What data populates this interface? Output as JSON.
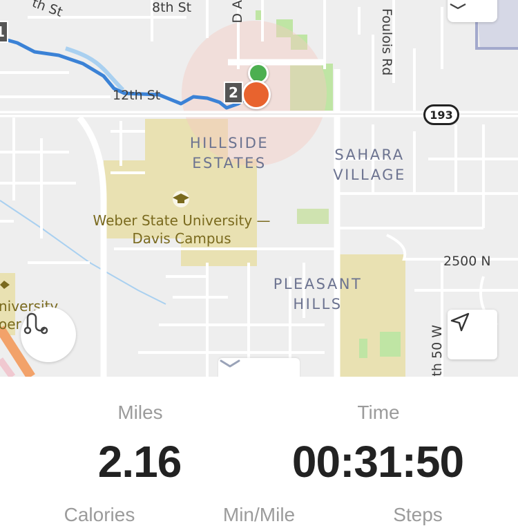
{
  "map": {
    "street_labels": [
      "8th St",
      "12th St",
      "Foulois Rd",
      "2500 N",
      "D A",
      "th St",
      "th 50 W"
    ],
    "route_shield": "193",
    "area_labels": [
      {
        "line1": "HILLSIDE",
        "line2": "ESTATES"
      },
      {
        "line1": "SAHARA",
        "line2": "VILLAGE"
      },
      {
        "line1": "PLEASANT",
        "line2": "HILLS"
      }
    ],
    "poi": {
      "line1": "Weber State University —",
      "line2": "Davis Campus"
    },
    "poi_partial": {
      "line1": "niversity",
      "line2": "oer"
    },
    "split_markers": [
      "1",
      "2"
    ],
    "start_marker_color": "#4caf50",
    "end_marker_color": "#e8632e",
    "route_color": "#3b82d6",
    "icons": {
      "route": "route-toggle-icon",
      "locate": "locate-arrow-icon",
      "layers": "layers-icon",
      "collapse": "chevron-down-icon"
    }
  },
  "stats": {
    "miles": {
      "label": "Miles",
      "value": "2.16"
    },
    "time": {
      "label": "Time",
      "value": "00:31:50"
    },
    "calories": {
      "label": "Calories"
    },
    "pace": {
      "label": "Min/Mile"
    },
    "steps": {
      "label": "Steps"
    }
  }
}
